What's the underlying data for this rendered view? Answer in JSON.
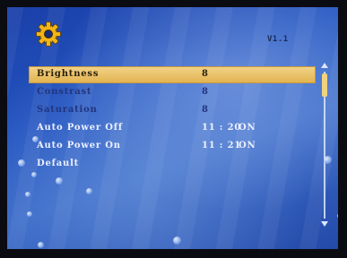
{
  "header": {
    "icon": "gear-icon",
    "version": "V1.1",
    "accent_color": "#f0b51a"
  },
  "menu": {
    "items": [
      {
        "label": "Brightness",
        "value": "8",
        "state": "",
        "selected": true,
        "dim": false
      },
      {
        "label": "Constrast",
        "value": "8",
        "state": "",
        "selected": false,
        "dim": true
      },
      {
        "label": "Saturation",
        "value": "8",
        "state": "",
        "selected": false,
        "dim": true
      },
      {
        "label": "Auto Power Off",
        "value": "11 : 20",
        "state": "ON",
        "selected": false,
        "dim": false
      },
      {
        "label": "Auto Power On",
        "value": "11 : 21",
        "state": "ON",
        "selected": false,
        "dim": false
      },
      {
        "label": "Default",
        "value": "",
        "state": "",
        "selected": false,
        "dim": false
      }
    ]
  },
  "scrollbar": {
    "up_icon": "triangle-up-icon",
    "down_icon": "triangle-down-icon"
  },
  "colors": {
    "selection": "#e8bd5e",
    "background": "#2454c0"
  }
}
